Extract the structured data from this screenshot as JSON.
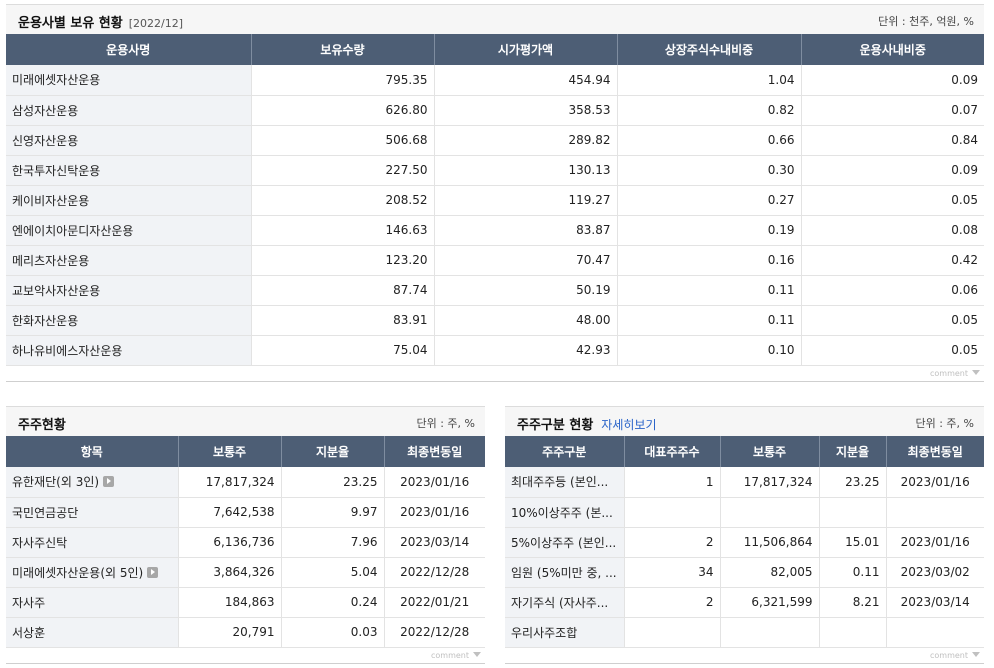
{
  "top": {
    "title": "운용사별 보유 현황",
    "date": "[2022/12]",
    "unit": "단위 : 천주, 억원, %",
    "headers": [
      "운용사명",
      "보유수량",
      "시가평가액",
      "상장주식수내비중",
      "운용사내비중"
    ],
    "rows": [
      [
        "미래에셋자산운용",
        "795.35",
        "454.94",
        "1.04",
        "0.09"
      ],
      [
        "삼성자산운용",
        "626.80",
        "358.53",
        "0.82",
        "0.07"
      ],
      [
        "신영자산운용",
        "506.68",
        "289.82",
        "0.66",
        "0.84"
      ],
      [
        "한국투자신탁운용",
        "227.50",
        "130.13",
        "0.30",
        "0.09"
      ],
      [
        "케이비자산운용",
        "208.52",
        "119.27",
        "0.27",
        "0.05"
      ],
      [
        "엔에이치아문디자산운용",
        "146.63",
        "83.87",
        "0.19",
        "0.08"
      ],
      [
        "메리츠자산운용",
        "123.20",
        "70.47",
        "0.16",
        "0.42"
      ],
      [
        "교보악사자산운용",
        "87.74",
        "50.19",
        "0.11",
        "0.06"
      ],
      [
        "한화자산운용",
        "83.91",
        "48.00",
        "0.11",
        "0.05"
      ],
      [
        "하나유비에스자산운용",
        "75.04",
        "42.93",
        "0.10",
        "0.05"
      ]
    ],
    "comment": "comment"
  },
  "shareholders": {
    "title": "주주현황",
    "unit": "단위 : 주, %",
    "headers": [
      "항목",
      "보통주",
      "지분율",
      "최종변동일"
    ],
    "rows": [
      [
        "유한재단(외 3인)",
        "17,817,324",
        "23.25",
        "2023/01/16"
      ],
      [
        "국민연금공단",
        "7,642,538",
        "9.97",
        "2023/01/16"
      ],
      [
        "자사주신탁",
        "6,136,736",
        "7.96",
        "2023/03/14"
      ],
      [
        "미래에셋자산운용(외 5인)",
        "3,864,326",
        "5.04",
        "2022/12/28"
      ],
      [
        "자사주",
        "184,863",
        "0.24",
        "2022/01/21"
      ],
      [
        "서상훈",
        "20,791",
        "0.03",
        "2022/12/28"
      ]
    ],
    "comment": "comment"
  },
  "classification": {
    "title": "주주구분 현황",
    "link": "자세히보기",
    "unit": "단위 : 주, %",
    "headers": [
      "주주구분",
      "대표주주수",
      "보통주",
      "지분율",
      "최종변동일"
    ],
    "rows": [
      [
        "최대주주등 (본인...",
        "1",
        "17,817,324",
        "23.25",
        "2023/01/16"
      ],
      [
        "10%이상주주 (본...",
        "",
        "",
        "",
        ""
      ],
      [
        "5%이상주주 (본인...",
        "2",
        "11,506,864",
        "15.01",
        "2023/01/16"
      ],
      [
        "임원 (5%미만 중, ...",
        "34",
        "82,005",
        "0.11",
        "2023/03/02"
      ],
      [
        "자기주식 (자사주...",
        "2",
        "6,321,599",
        "8.21",
        "2023/03/14"
      ],
      [
        "우리사주조합",
        "",
        "",
        "",
        ""
      ]
    ],
    "comment": "comment"
  }
}
